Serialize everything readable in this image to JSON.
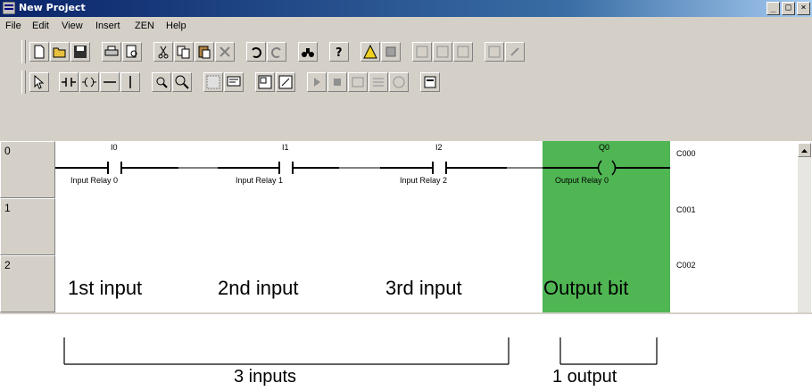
{
  "window": {
    "title": "New Project",
    "minimize": "_",
    "restore": "□",
    "close": "×"
  },
  "menu": [
    {
      "label": "File"
    },
    {
      "label": "Edit"
    },
    {
      "label": "View"
    },
    {
      "label": "Insert"
    },
    {
      "label": "ZEN"
    },
    {
      "label": "Help"
    }
  ],
  "ladder": {
    "rung_numbers": [
      "0",
      "1",
      "2"
    ],
    "contacts": [
      {
        "addr": "I0",
        "label": "Input Relay 0"
      },
      {
        "addr": "I1",
        "label": "Input Relay 1"
      },
      {
        "addr": "I2",
        "label": "Input Relay 2"
      }
    ],
    "coil": {
      "addr": "Q0",
      "label": "Output Relay 0"
    },
    "line_addresses": [
      "C000",
      "C001",
      "C002"
    ],
    "overlay_labels": [
      "1st input",
      "2nd input",
      "3rd input",
      "Output bit"
    ]
  },
  "annotations": {
    "inputs": "3 inputs",
    "output": "1 output"
  },
  "colors": {
    "output_highlight": "#4fb653",
    "titlebar": "#0a246a"
  }
}
